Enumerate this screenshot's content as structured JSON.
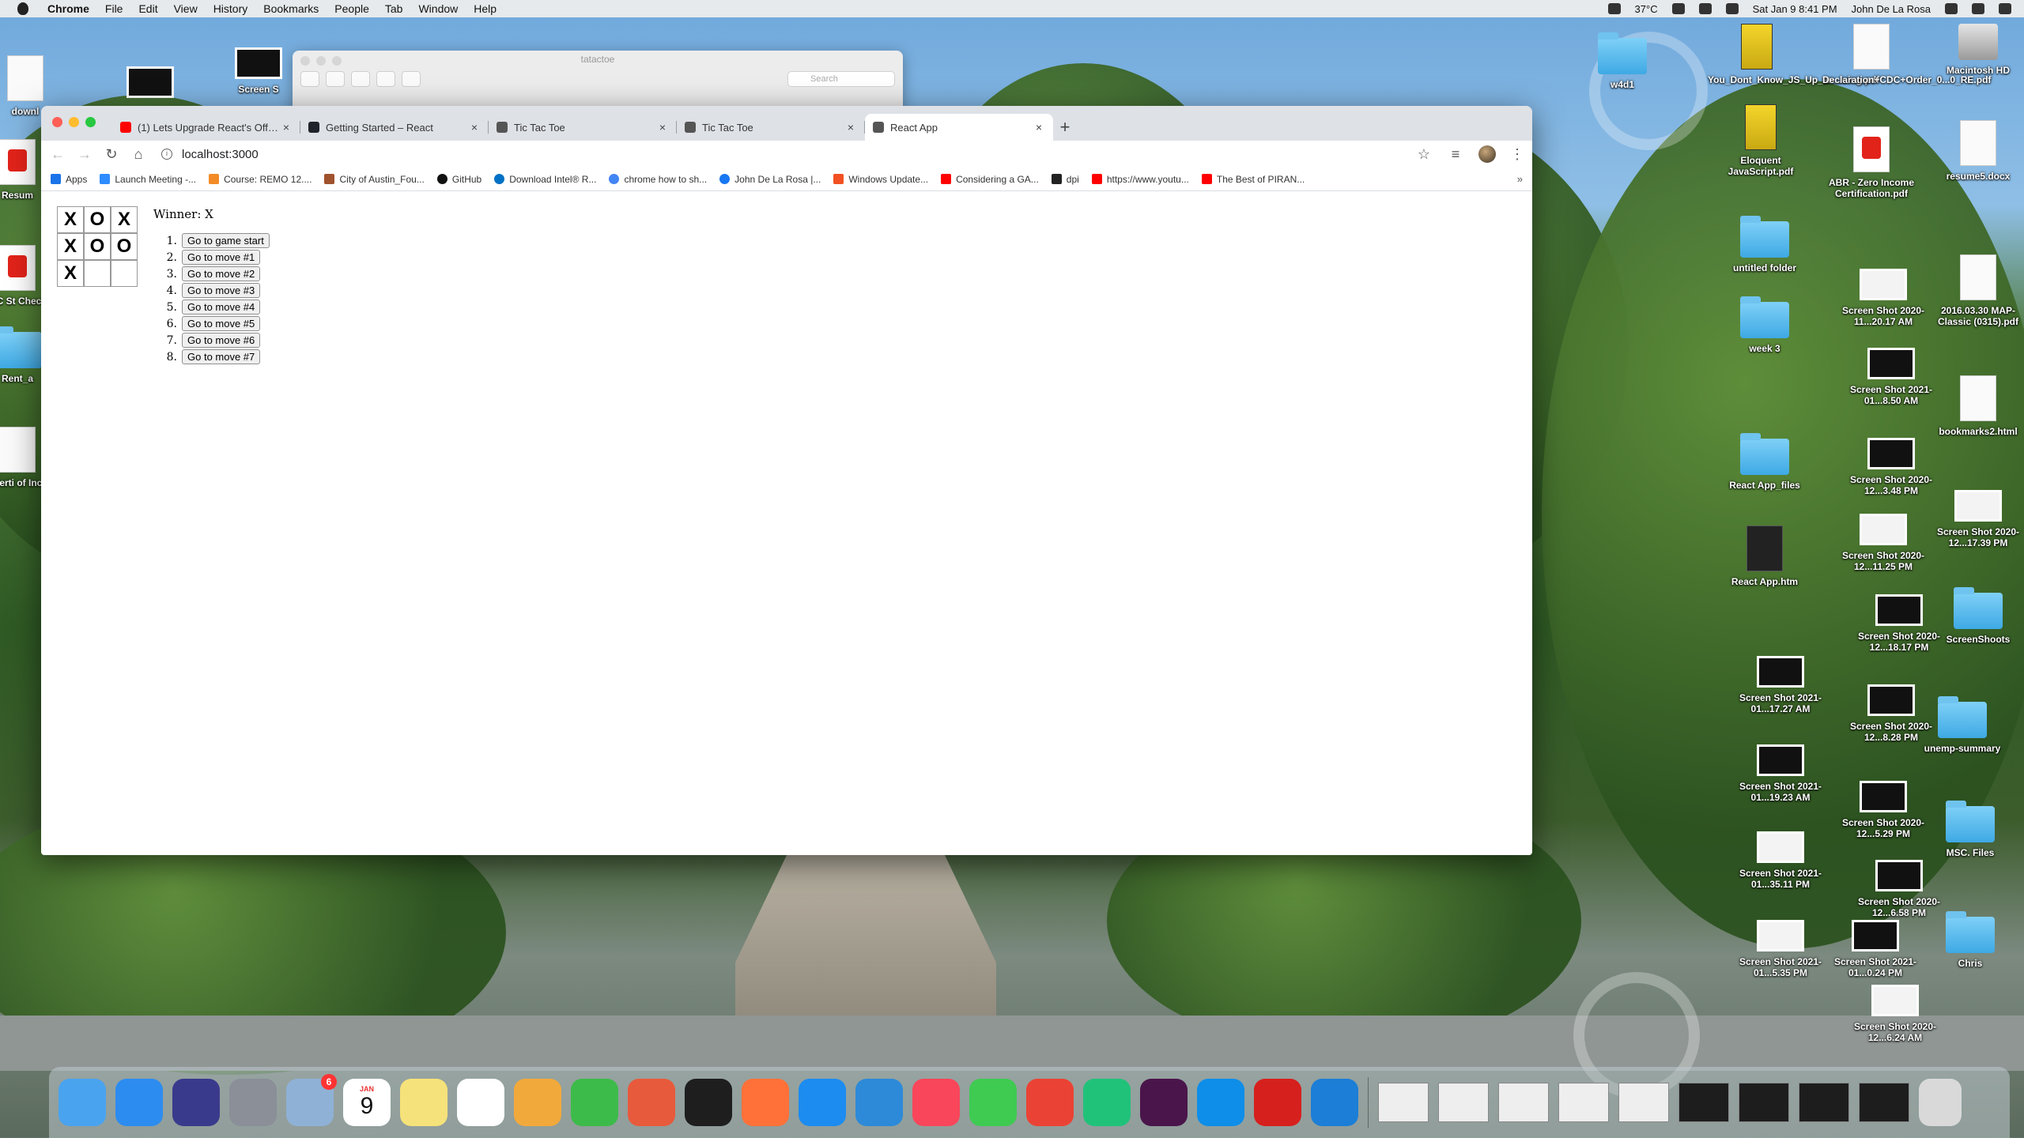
{
  "menubar": {
    "app_name": "Chrome",
    "menus": [
      "File",
      "Edit",
      "View",
      "History",
      "Bookmarks",
      "People",
      "Tab",
      "Window",
      "Help"
    ],
    "temperature": "37°C",
    "datetime": "Sat Jan 9  8:41 PM",
    "user": "John De La Rosa"
  },
  "finder": {
    "title": "tatactoe",
    "search_placeholder": "Search"
  },
  "chrome": {
    "tabs": [
      {
        "title": "(1) Lets Upgrade React's Official",
        "favicon_color": "#ff0000",
        "active": false
      },
      {
        "title": "Getting Started – React",
        "favicon_color": "#20232a",
        "active": false
      },
      {
        "title": "Tic Tac Toe",
        "favicon_color": "#555555",
        "active": false
      },
      {
        "title": "Tic Tac Toe",
        "favicon_color": "#555555",
        "active": false
      },
      {
        "title": "React App",
        "favicon_color": "#555555",
        "active": true
      }
    ],
    "url": "localhost:3000",
    "bookmarks": [
      {
        "label": "Apps",
        "color": "#1a73e8"
      },
      {
        "label": "Launch Meeting -...",
        "color": "#2d8cff"
      },
      {
        "label": "Course: REMO 12....",
        "color": "#f28b26"
      },
      {
        "label": "City of Austin_Fou...",
        "color": "#a0522d"
      },
      {
        "label": "GitHub",
        "color": "#111111"
      },
      {
        "label": "Download Intel® R...",
        "color": "#0071c5"
      },
      {
        "label": "chrome how to sh...",
        "color": "#4285f4"
      },
      {
        "label": "John De La Rosa |...",
        "color": "#1877f2"
      },
      {
        "label": "Windows Update...",
        "color": "#f25022"
      },
      {
        "label": "Considering a GA...",
        "color": "#ff0000"
      },
      {
        "label": "dpi",
        "color": "#222222"
      },
      {
        "label": "https://www.youtu...",
        "color": "#ff0000"
      },
      {
        "label": "The Best of PIRAN...",
        "color": "#ff0000"
      }
    ]
  },
  "game": {
    "board": [
      "X",
      "O",
      "X",
      "X",
      "O",
      "O",
      "X",
      "",
      ""
    ],
    "status": "Winner: X",
    "moves": [
      {
        "num": "1.",
        "label": "Go to game start"
      },
      {
        "num": "2.",
        "label": "Go to move #1"
      },
      {
        "num": "3.",
        "label": "Go to move #2"
      },
      {
        "num": "4.",
        "label": "Go to move #3"
      },
      {
        "num": "5.",
        "label": "Go to move #4"
      },
      {
        "num": "6.",
        "label": "Go to move #5"
      },
      {
        "num": "7.",
        "label": "Go to move #6"
      },
      {
        "num": "8.",
        "label": "Go to move #7"
      }
    ]
  },
  "desktop": {
    "left_labels": [
      "downl",
      "Screen S",
      "Resum",
      "RZNC St Check Li",
      "Rent_a",
      "elf-Certi of Incom"
    ],
    "icons": [
      {
        "label": "w4d1",
        "kind": "folder"
      },
      {
        "label": "You_Dont_Know_JS_Up_an...oing.pdf",
        "kind": "book"
      },
      {
        "label": "Declaration+CDC+Order_0...0_RE.pdf",
        "kind": "doc"
      },
      {
        "label": "Macintosh HD",
        "kind": "drive"
      },
      {
        "label": "Eloquent JavaScript.pdf",
        "kind": "book"
      },
      {
        "label": "ABR - Zero Income Certification.pdf",
        "kind": "pdf"
      },
      {
        "label": "resume5.docx",
        "kind": "doc"
      },
      {
        "label": "untitled folder",
        "kind": "folder"
      },
      {
        "label": "Screen Shot 2020-11...20.17 AM",
        "kind": "shot-light"
      },
      {
        "label": "2016.03.30 MAP-Classic (0315).pdf",
        "kind": "doc"
      },
      {
        "label": "week 3",
        "kind": "folder"
      },
      {
        "label": "Screen Shot 2021-01...8.50 AM",
        "kind": "shot"
      },
      {
        "label": "bookmarks2.html",
        "kind": "doc"
      },
      {
        "label": "React App_files",
        "kind": "folder"
      },
      {
        "label": "Screen Shot 2020-12...3.48 PM",
        "kind": "shot"
      },
      {
        "label": "Screen Shot 2020-12...11.25 PM",
        "kind": "shot-light"
      },
      {
        "label": "Screen Shot 2020-12...17.39 PM",
        "kind": "shot-light"
      },
      {
        "label": "React App.htm",
        "kind": "html"
      },
      {
        "label": "Screen Shot 2020-12...18.17 PM",
        "kind": "shot"
      },
      {
        "label": "ScreenShoots",
        "kind": "folder"
      },
      {
        "label": "Screen Shot 2021-01...17.27 AM",
        "kind": "shot"
      },
      {
        "label": "Screen Shot 2020-12...8.28 PM",
        "kind": "shot"
      },
      {
        "label": "unemp-summary",
        "kind": "folder"
      },
      {
        "label": "Screen Shot 2021-01...19.23 AM",
        "kind": "shot"
      },
      {
        "label": "Screen Shot 2020-12...5.29 PM",
        "kind": "shot"
      },
      {
        "label": "MSC. Files",
        "kind": "folder"
      },
      {
        "label": "Screen Shot 2021-01...35.11 PM",
        "kind": "shot-light"
      },
      {
        "label": "Screen Shot 2020-12...6.58 PM",
        "kind": "shot"
      },
      {
        "label": "Screen Shot 2021-01...5.35 PM",
        "kind": "shot-light"
      },
      {
        "label": "Screen Shot 2021-01...0.24 PM",
        "kind": "shot"
      },
      {
        "label": "Chris",
        "kind": "folder"
      },
      {
        "label": "Screen Shot 2020-12...6.24 AM",
        "kind": "shot-light"
      }
    ]
  },
  "dock": {
    "apps": [
      {
        "name": "Finder",
        "color": "#4aa3ee"
      },
      {
        "name": "Safari",
        "color": "#2d8cf0"
      },
      {
        "name": "Siri",
        "color": "#3a3a8c"
      },
      {
        "name": "Launchpad",
        "color": "#8a8f98"
      },
      {
        "name": "Preview",
        "color": "#8fb1d6",
        "badge": "6"
      },
      {
        "name": "Calendar",
        "color": "#ffffff",
        "month": "JAN",
        "day": "9"
      },
      {
        "name": "Notes",
        "color": "#f6e27a"
      },
      {
        "name": "Reminders",
        "color": "#ffffff"
      },
      {
        "name": "Photos",
        "color": "#f2a93b"
      },
      {
        "name": "Messages",
        "color": "#3dbb4a"
      },
      {
        "name": "Remote Desktop",
        "color": "#e85a3c"
      },
      {
        "name": "Terminal",
        "color": "#1e1e1e"
      },
      {
        "name": "Firefox",
        "color": "#ff7139"
      },
      {
        "name": "App Store",
        "color": "#1c8cf0"
      },
      {
        "name": "VS Code",
        "color": "#2d8ad8"
      },
      {
        "name": "Music",
        "color": "#f9465a"
      },
      {
        "name": "FaceTime",
        "color": "#3fca52"
      },
      {
        "name": "Chrome",
        "color": "#ea4335"
      },
      {
        "name": "PyCharm",
        "color": "#20c27a"
      },
      {
        "name": "Slack",
        "color": "#4a154b"
      },
      {
        "name": "TeamViewer",
        "color": "#0e8ee9"
      },
      {
        "name": "Acrobat",
        "color": "#d6201d"
      },
      {
        "name": "Xcode",
        "color": "#1c7ed6"
      }
    ]
  }
}
